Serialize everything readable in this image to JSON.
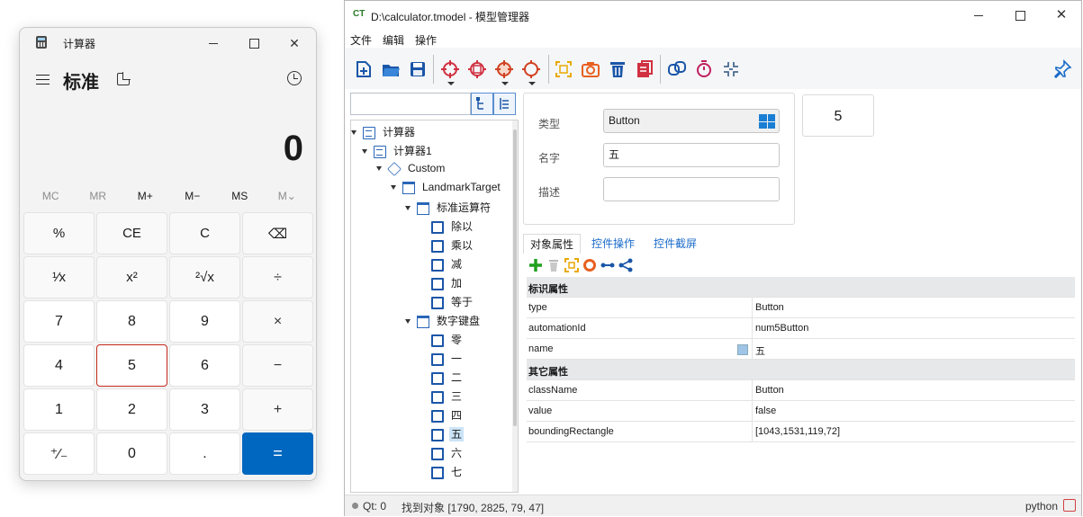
{
  "calculator": {
    "title": "计算器",
    "mode": "标准",
    "display": "0",
    "memory": [
      "MC",
      "MR",
      "M+",
      "M−",
      "MS",
      "M⌄"
    ],
    "keys": [
      {
        "label": "%",
        "kind": "fn"
      },
      {
        "label": "CE",
        "kind": "fn"
      },
      {
        "label": "C",
        "kind": "fn"
      },
      {
        "label": "⌫",
        "kind": "fn"
      },
      {
        "label": "¹⁄x",
        "kind": "fn"
      },
      {
        "label": "x²",
        "kind": "fn"
      },
      {
        "label": "²√x",
        "kind": "fn"
      },
      {
        "label": "÷",
        "kind": "op"
      },
      {
        "label": "7",
        "kind": "num"
      },
      {
        "label": "8",
        "kind": "num"
      },
      {
        "label": "9",
        "kind": "num"
      },
      {
        "label": "×",
        "kind": "op"
      },
      {
        "label": "4",
        "kind": "num"
      },
      {
        "label": "5",
        "kind": "num",
        "selected": true
      },
      {
        "label": "6",
        "kind": "num"
      },
      {
        "label": "−",
        "kind": "op"
      },
      {
        "label": "1",
        "kind": "num"
      },
      {
        "label": "2",
        "kind": "num"
      },
      {
        "label": "3",
        "kind": "num"
      },
      {
        "label": "+",
        "kind": "op"
      },
      {
        "label": "⁺⁄₋",
        "kind": "num"
      },
      {
        "label": "0",
        "kind": "num"
      },
      {
        "label": ".",
        "kind": "num"
      },
      {
        "label": "=",
        "kind": "eq"
      }
    ]
  },
  "manager": {
    "title": "D:\\calculator.tmodel - 模型管理器",
    "logo": "CT",
    "menu": [
      "文件",
      "编辑",
      "操作"
    ],
    "tree": [
      {
        "label": "计算器",
        "level": 0,
        "icon": "form"
      },
      {
        "label": "计算器1",
        "level": 1,
        "icon": "form"
      },
      {
        "label": "Custom",
        "level": 2,
        "icon": "cube"
      },
      {
        "label": "LandmarkTarget",
        "level": 3,
        "icon": "group"
      },
      {
        "label": "标准运算符",
        "level": 4,
        "icon": "group"
      },
      {
        "label": "除以",
        "level": 5,
        "icon": "btn"
      },
      {
        "label": "乘以",
        "level": 5,
        "icon": "btn"
      },
      {
        "label": "减",
        "level": 5,
        "icon": "btn"
      },
      {
        "label": "加",
        "level": 5,
        "icon": "btn"
      },
      {
        "label": "等于",
        "level": 5,
        "icon": "btn"
      },
      {
        "label": "数字键盘",
        "level": 4,
        "icon": "group"
      },
      {
        "label": "零",
        "level": 5,
        "icon": "btn"
      },
      {
        "label": "一",
        "level": 5,
        "icon": "btn"
      },
      {
        "label": "二",
        "level": 5,
        "icon": "btn"
      },
      {
        "label": "三",
        "level": 5,
        "icon": "btn"
      },
      {
        "label": "四",
        "level": 5,
        "icon": "btn"
      },
      {
        "label": "五",
        "level": 5,
        "icon": "btn",
        "selected": true
      },
      {
        "label": "六",
        "level": 5,
        "icon": "btn"
      },
      {
        "label": "七",
        "level": 5,
        "icon": "btn"
      }
    ],
    "fields": {
      "type_label": "类型",
      "type_value": "Button",
      "name_label": "名字",
      "name_value": "五",
      "desc_label": "描述",
      "desc_value": ""
    },
    "count": "5",
    "tabs": [
      "对象属性",
      "控件操作",
      "控件截屏"
    ],
    "grid": [
      {
        "key": "标识属性",
        "section": true
      },
      {
        "key": "type",
        "value": "Button"
      },
      {
        "key": "automationId",
        "value": "num5Button"
      },
      {
        "key": "name",
        "value": "五",
        "chip": true
      },
      {
        "key": "其它属性",
        "section": true
      },
      {
        "key": "className",
        "value": "Button"
      },
      {
        "key": "value",
        "value": "false"
      },
      {
        "key": "boundingRectangle",
        "value": "[1043,1531,119,72]"
      }
    ],
    "status": {
      "qt": "Qt: 0",
      "message": "找到对象 [1790, 2825, 79, 47]",
      "python": "python"
    }
  }
}
